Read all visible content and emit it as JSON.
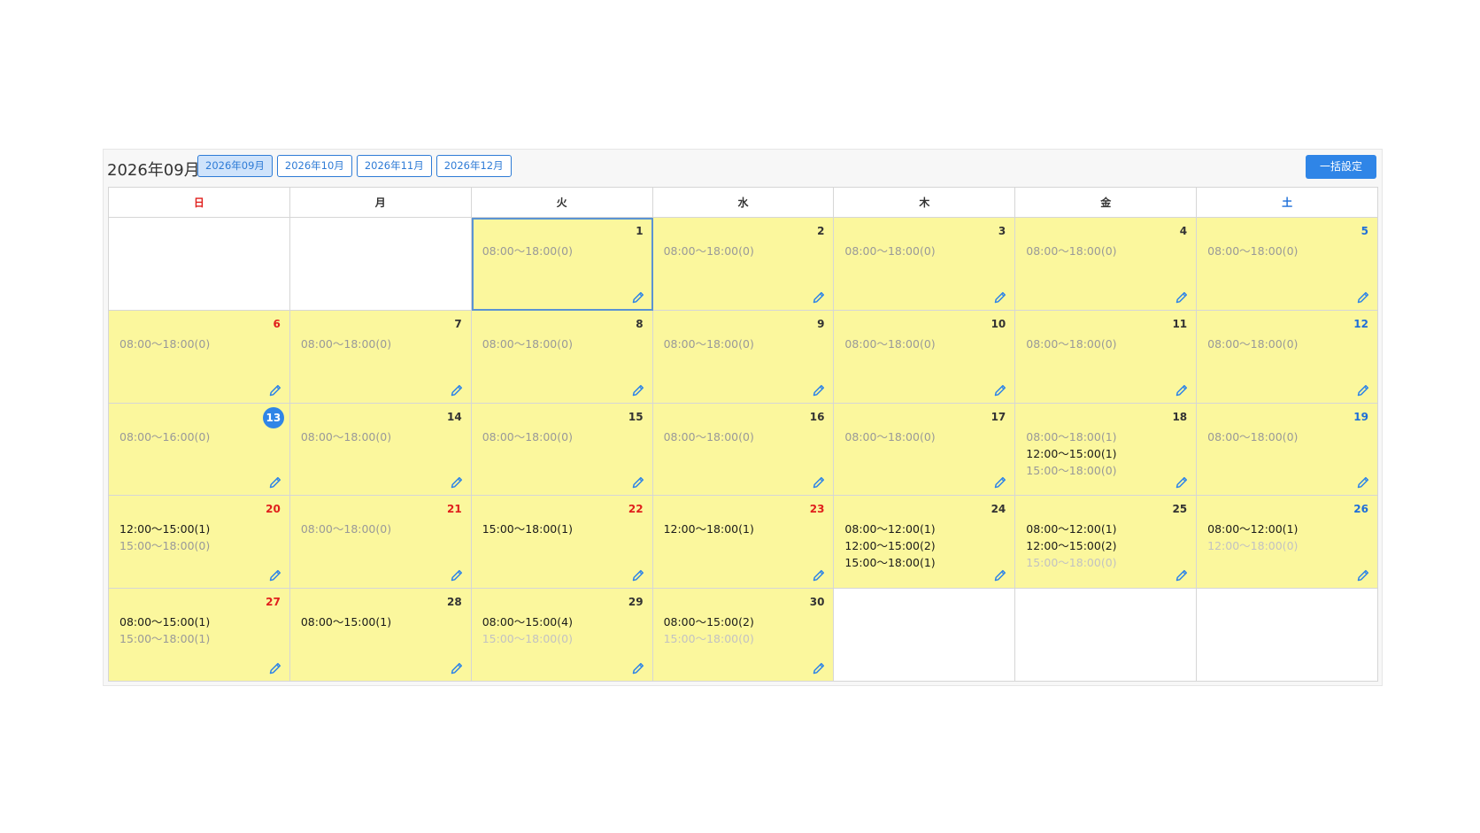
{
  "header": {
    "current_month": "2026年09月",
    "tabs": [
      {
        "label": "2026年09月",
        "active": true
      },
      {
        "label": "2026年10月",
        "active": false
      },
      {
        "label": "2026年11月",
        "active": false
      },
      {
        "label": "2026年12月",
        "active": false
      }
    ],
    "bulk_button": "一括設定"
  },
  "weekdays": [
    {
      "label": "日",
      "kind": "sun"
    },
    {
      "label": "月",
      "kind": ""
    },
    {
      "label": "火",
      "kind": ""
    },
    {
      "label": "水",
      "kind": ""
    },
    {
      "label": "木",
      "kind": ""
    },
    {
      "label": "金",
      "kind": ""
    },
    {
      "label": "土",
      "kind": "sat"
    }
  ],
  "colors": {
    "accent": "#2f85e7",
    "available_cell": "#fbf79d",
    "holiday_red": "#e0201d",
    "saturday_blue": "#1e6fd9"
  },
  "icons": {
    "edit": "pencil-icon"
  },
  "weeks": [
    [
      null,
      null,
      {
        "day": "1",
        "color": "",
        "selected": true,
        "slots": [
          {
            "text": "08:00〜18:00(0)",
            "style": "gray"
          }
        ]
      },
      {
        "day": "2",
        "color": "",
        "slots": [
          {
            "text": "08:00〜18:00(0)",
            "style": "gray"
          }
        ]
      },
      {
        "day": "3",
        "color": "",
        "slots": [
          {
            "text": "08:00〜18:00(0)",
            "style": "gray"
          }
        ]
      },
      {
        "day": "4",
        "color": "",
        "slots": [
          {
            "text": "08:00〜18:00(0)",
            "style": "gray"
          }
        ]
      },
      {
        "day": "5",
        "color": "blue",
        "slots": [
          {
            "text": "08:00〜18:00(0)",
            "style": "gray"
          }
        ]
      }
    ],
    [
      {
        "day": "6",
        "color": "red",
        "slots": [
          {
            "text": "08:00〜18:00(0)",
            "style": "gray"
          }
        ]
      },
      {
        "day": "7",
        "color": "",
        "slots": [
          {
            "text": "08:00〜18:00(0)",
            "style": "gray"
          }
        ]
      },
      {
        "day": "8",
        "color": "",
        "slots": [
          {
            "text": "08:00〜18:00(0)",
            "style": "gray"
          }
        ]
      },
      {
        "day": "9",
        "color": "",
        "slots": [
          {
            "text": "08:00〜18:00(0)",
            "style": "gray"
          }
        ]
      },
      {
        "day": "10",
        "color": "",
        "slots": [
          {
            "text": "08:00〜18:00(0)",
            "style": "gray"
          }
        ]
      },
      {
        "day": "11",
        "color": "",
        "slots": [
          {
            "text": "08:00〜18:00(0)",
            "style": "gray"
          }
        ]
      },
      {
        "day": "12",
        "color": "blue",
        "slots": [
          {
            "text": "08:00〜18:00(0)",
            "style": "gray"
          }
        ]
      }
    ],
    [
      {
        "day": "13",
        "color": "",
        "today": true,
        "slots": [
          {
            "text": "08:00〜16:00(0)",
            "style": "gray"
          }
        ]
      },
      {
        "day": "14",
        "color": "",
        "slots": [
          {
            "text": "08:00〜18:00(0)",
            "style": "gray"
          }
        ]
      },
      {
        "day": "15",
        "color": "",
        "slots": [
          {
            "text": "08:00〜18:00(0)",
            "style": "gray"
          }
        ]
      },
      {
        "day": "16",
        "color": "",
        "slots": [
          {
            "text": "08:00〜18:00(0)",
            "style": "gray"
          }
        ]
      },
      {
        "day": "17",
        "color": "",
        "slots": [
          {
            "text": "08:00〜18:00(0)",
            "style": "gray"
          }
        ]
      },
      {
        "day": "18",
        "color": "",
        "slots": [
          {
            "text": "08:00〜18:00(1)",
            "style": "gray"
          },
          {
            "text": "12:00〜15:00(1)",
            "style": "dark"
          },
          {
            "text": "15:00〜18:00(0)",
            "style": "gray"
          }
        ]
      },
      {
        "day": "19",
        "color": "blue",
        "slots": [
          {
            "text": "08:00〜18:00(0)",
            "style": "gray"
          }
        ]
      }
    ],
    [
      {
        "day": "20",
        "color": "red",
        "slots": [
          {
            "text": "12:00〜15:00(1)",
            "style": "dark"
          },
          {
            "text": "15:00〜18:00(0)",
            "style": "gray"
          }
        ]
      },
      {
        "day": "21",
        "color": "red",
        "slots": [
          {
            "text": "08:00〜18:00(0)",
            "style": "gray"
          }
        ]
      },
      {
        "day": "22",
        "color": "red",
        "slots": [
          {
            "text": "15:00〜18:00(1)",
            "style": "dark"
          }
        ]
      },
      {
        "day": "23",
        "color": "red",
        "slots": [
          {
            "text": "12:00〜18:00(1)",
            "style": "dark"
          }
        ]
      },
      {
        "day": "24",
        "color": "",
        "slots": [
          {
            "text": "08:00〜12:00(1)",
            "style": "dark"
          },
          {
            "text": "12:00〜15:00(2)",
            "style": "dark"
          },
          {
            "text": "15:00〜18:00(1)",
            "style": "dark"
          }
        ]
      },
      {
        "day": "25",
        "color": "",
        "slots": [
          {
            "text": "08:00〜12:00(1)",
            "style": "dark"
          },
          {
            "text": "12:00〜15:00(2)",
            "style": "dark"
          },
          {
            "text": "15:00〜18:00(0)",
            "style": "light"
          }
        ]
      },
      {
        "day": "26",
        "color": "blue",
        "slots": [
          {
            "text": "08:00〜12:00(1)",
            "style": "dark"
          },
          {
            "text": "12:00〜18:00(0)",
            "style": "light"
          }
        ]
      }
    ],
    [
      {
        "day": "27",
        "color": "red",
        "slots": [
          {
            "text": "08:00〜15:00(1)",
            "style": "dark"
          },
          {
            "text": "15:00〜18:00(1)",
            "style": "gray"
          }
        ]
      },
      {
        "day": "28",
        "color": "",
        "slots": [
          {
            "text": "08:00〜15:00(1)",
            "style": "dark"
          }
        ]
      },
      {
        "day": "29",
        "color": "",
        "slots": [
          {
            "text": "08:00〜15:00(4)",
            "style": "dark"
          },
          {
            "text": "15:00〜18:00(0)",
            "style": "light"
          }
        ]
      },
      {
        "day": "30",
        "color": "",
        "slots": [
          {
            "text": "08:00〜15:00(2)",
            "style": "dark"
          },
          {
            "text": "15:00〜18:00(0)",
            "style": "light"
          }
        ]
      },
      null,
      null,
      null
    ]
  ]
}
